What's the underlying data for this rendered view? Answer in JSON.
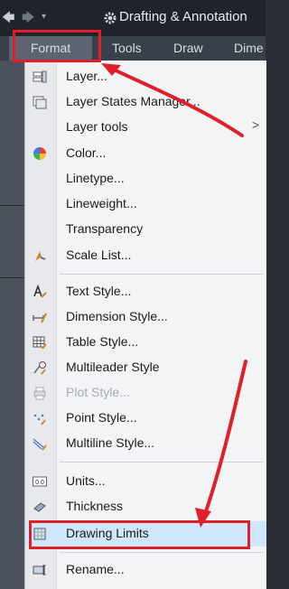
{
  "quick_access": {
    "back": "🡄",
    "forward": "🡆",
    "dropdown": "▾"
  },
  "workspace": {
    "title": "Drafting & Annotation",
    "icon": "gear-icon"
  },
  "menubar": {
    "items": [
      "Format",
      "Tools",
      "Draw",
      "Dime"
    ]
  },
  "menu": {
    "items": [
      {
        "label": "Layer...",
        "icon": "layer-icon"
      },
      {
        "label": "Layer States Manager...",
        "icon": "layer-states-icon"
      },
      {
        "label": "Layer tools",
        "submenu_arrow": ">"
      },
      {
        "label": "Color...",
        "icon": "color-wheel-icon"
      },
      {
        "label": "Linetype..."
      },
      {
        "label": "Lineweight..."
      },
      {
        "label": "Transparency"
      },
      {
        "label": "Scale List...",
        "icon": "scale-list-icon"
      },
      {
        "label": "Text Style...",
        "icon": "text-style-icon"
      },
      {
        "label": "Dimension Style...",
        "icon": "dimension-style-icon"
      },
      {
        "label": "Table Style...",
        "icon": "table-style-icon"
      },
      {
        "label": "Multileader Style",
        "icon": "multileader-style-icon"
      },
      {
        "label": "Plot Style...",
        "icon": "plot-style-icon",
        "disabled": true
      },
      {
        "label": "Point Style...",
        "icon": "point-style-icon"
      },
      {
        "label": "Multiline Style...",
        "icon": "multiline-style-icon"
      },
      {
        "label": "Units...",
        "icon": "units-icon",
        "icon_text": "0.0"
      },
      {
        "label": "Thickness",
        "icon": "thickness-icon"
      },
      {
        "label": "Drawing Limits",
        "icon": "drawing-limits-icon",
        "highlighted": true
      },
      {
        "label": "Rename...",
        "icon": "rename-icon"
      }
    ]
  },
  "colors": {
    "annotation": "#e01f2b",
    "highlight": "#cfe7fb"
  }
}
